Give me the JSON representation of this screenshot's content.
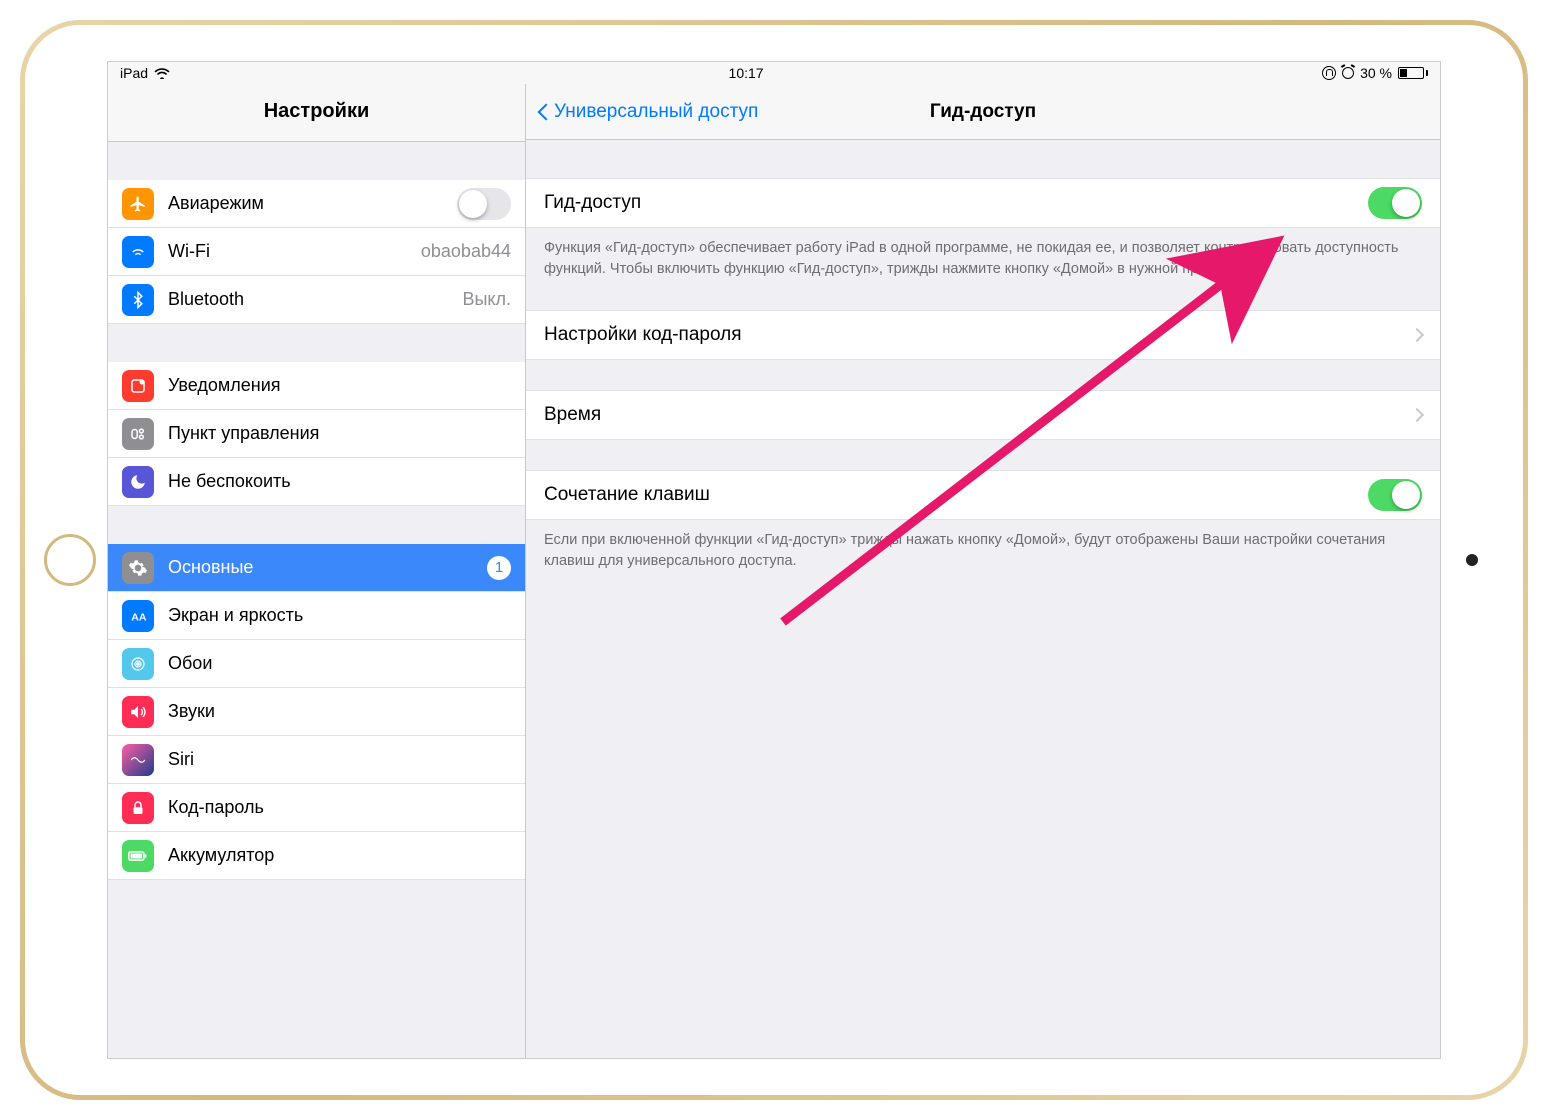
{
  "statusbar": {
    "device": "iPad",
    "time": "10:17",
    "battery_pct": "30 %"
  },
  "sidebar": {
    "title": "Настройки",
    "airplane": {
      "label": "Авиарежим",
      "on": false
    },
    "wifi": {
      "label": "Wi-Fi",
      "value": "obaobab44"
    },
    "bluetooth": {
      "label": "Bluetooth",
      "value": "Выкл."
    },
    "notifications": {
      "label": "Уведомления"
    },
    "control_center": {
      "label": "Пункт управления"
    },
    "dnd": {
      "label": "Не беспокоить"
    },
    "general": {
      "label": "Основные",
      "badge": "1"
    },
    "display": {
      "label": "Экран и яркость"
    },
    "wallpaper": {
      "label": "Обои"
    },
    "sounds": {
      "label": "Звуки"
    },
    "siri": {
      "label": "Siri"
    },
    "passcode": {
      "label": "Код-пароль"
    },
    "battery": {
      "label": "Аккумулятор"
    }
  },
  "detail": {
    "back": "Универсальный доступ",
    "title": "Гид-доступ",
    "guided_access": {
      "label": "Гид-доступ",
      "on": true
    },
    "guided_footer": "Функция «Гид-доступ» обеспечивает работу iPad в одной программе, не покидая ее, и позволяет контролировать доступность функций. Чтобы включить функцию «Гид-доступ», трижды нажмите кнопку «Домой» в нужной программе.",
    "passcode_row": "Настройки код-пароля",
    "time_row": "Время",
    "shortcut": {
      "label": "Сочетание клавиш",
      "on": true
    },
    "shortcut_footer": "Если при включенной функции «Гид-доступ» трижды нажать кнопку «Домой», будут отображены Ваши настройки сочетания клавиш для универсального доступа."
  }
}
